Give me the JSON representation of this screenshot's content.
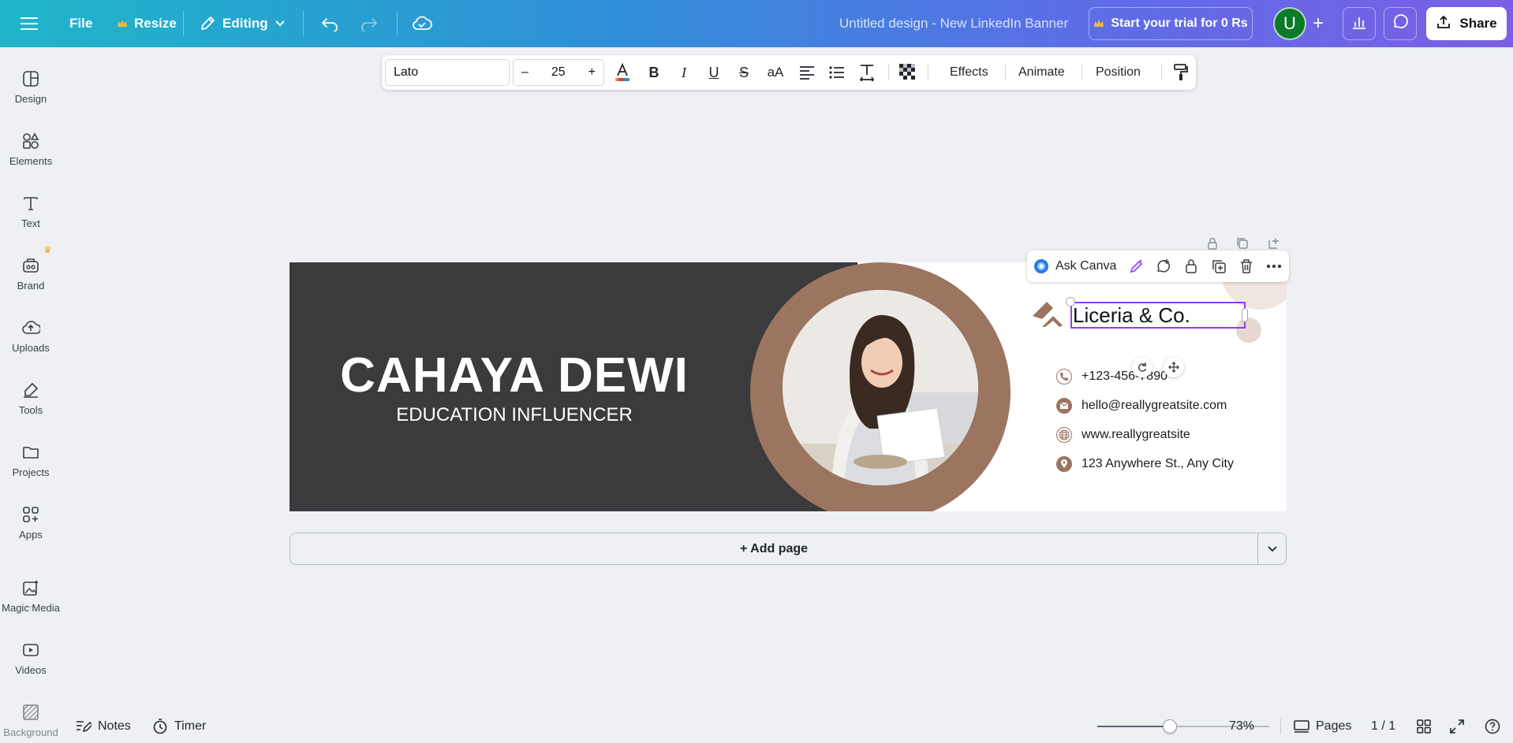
{
  "topbar": {
    "menu_icon": "hamburger-icon",
    "file_label": "File",
    "resize_label": "Resize",
    "editing_label": "Editing",
    "doc_title": "Untitled design - New LinkedIn Banner",
    "trial_label": "Start your trial for 0 Rs",
    "avatar_letter": "U",
    "share_label": "Share"
  },
  "sidebar": {
    "items": [
      {
        "label": "Design",
        "icon": "design-icon"
      },
      {
        "label": "Elements",
        "icon": "elements-icon"
      },
      {
        "label": "Text",
        "icon": "text-icon"
      },
      {
        "label": "Brand",
        "icon": "brand-icon"
      },
      {
        "label": "Uploads",
        "icon": "uploads-icon"
      },
      {
        "label": "Tools",
        "icon": "tools-icon"
      },
      {
        "label": "Projects",
        "icon": "projects-icon"
      },
      {
        "label": "Apps",
        "icon": "apps-icon"
      },
      {
        "label": "Magic Media",
        "icon": "magic-media-icon"
      },
      {
        "label": "Videos",
        "icon": "videos-icon"
      },
      {
        "label": "Background",
        "icon": "background-icon"
      }
    ]
  },
  "text_toolbar": {
    "font": "Lato",
    "decrease": "–",
    "size": "25",
    "increase": "+",
    "case_label": "aA",
    "effects": "Effects",
    "animate": "Animate",
    "position": "Position"
  },
  "floating_toolbar": {
    "ask_canva": "Ask Canva"
  },
  "banner": {
    "name": "CAHAYA DEWI",
    "role": "EDUCATION INFLUENCER",
    "company": "Liceria & Co.",
    "contacts": [
      {
        "icon": "phone-icon",
        "text": "+123-456-7890"
      },
      {
        "icon": "mail-icon",
        "text": "hello@reallygreatsite.com"
      },
      {
        "icon": "globe-icon",
        "text": "www.reallygreatsite"
      },
      {
        "icon": "location-icon",
        "text": "123 Anywhere St., Any City"
      }
    ]
  },
  "add_page": "+ Add page",
  "bottombar": {
    "notes": "Notes",
    "timer": "Timer",
    "zoom": "73%",
    "zoom_level": 0.42,
    "pages": "Pages",
    "page_count": "1 / 1",
    "help": "?"
  },
  "colors": {
    "accent": "#8b3dff",
    "banner_dark": "#3b3a3c",
    "banner_brown": "#9b7560",
    "avatar": "#0c7a2a"
  }
}
